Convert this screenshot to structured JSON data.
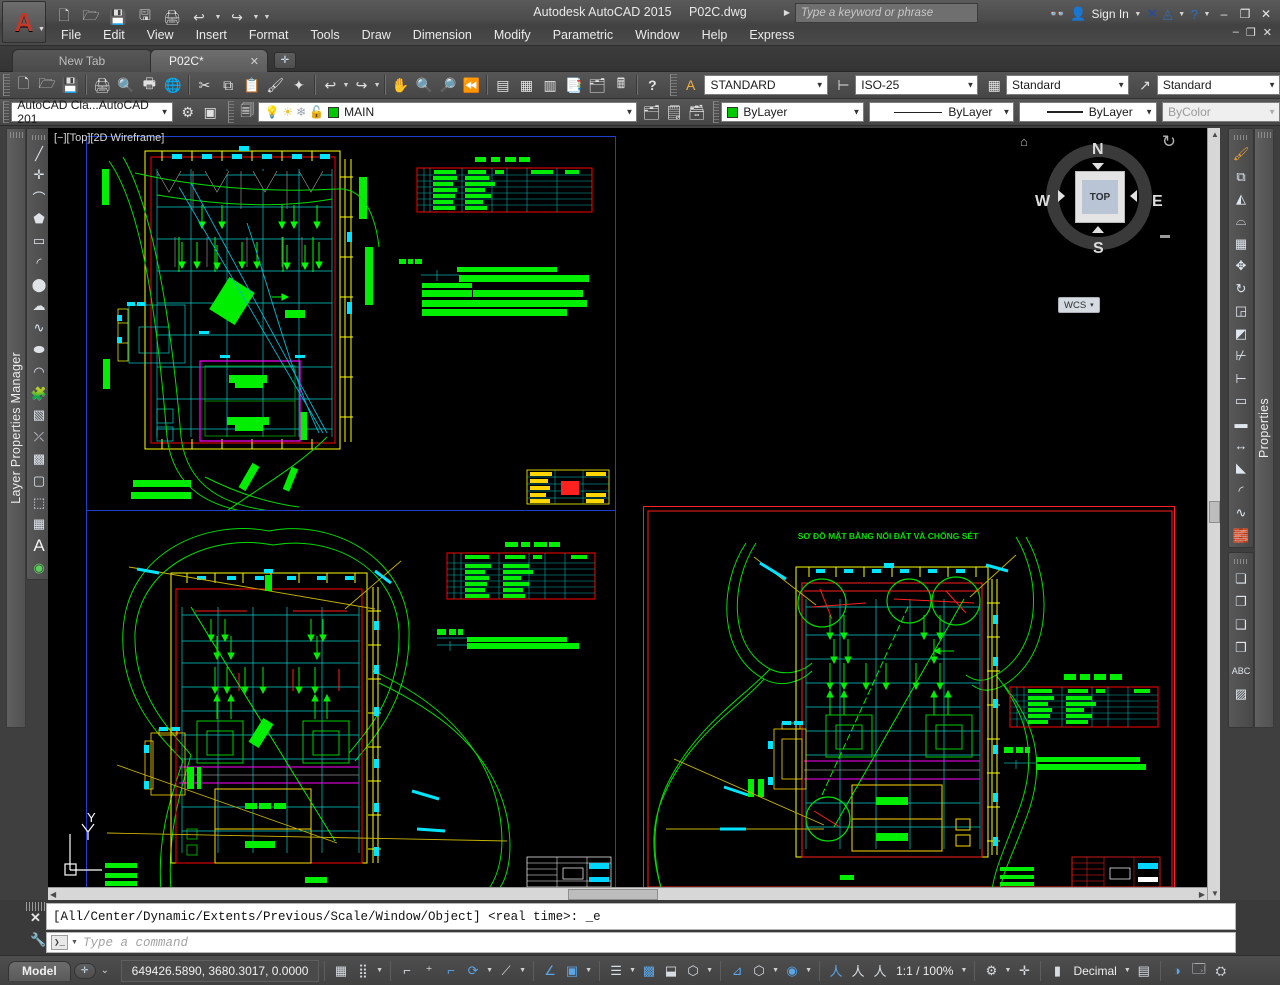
{
  "titlebar": {
    "app_logo": "autocad-a-logo",
    "product": "Autodesk AutoCAD 2015",
    "filename": "P02C.dwg",
    "search_placeholder": "Type a keyword or phrase",
    "signin_label": "Sign In",
    "quick_access": [
      {
        "name": "new-file-icon",
        "glyph": "🗋"
      },
      {
        "name": "open-file-icon",
        "glyph": "🗁"
      },
      {
        "name": "save-icon",
        "glyph": "💾"
      },
      {
        "name": "save-as-icon",
        "glyph": "🖫"
      },
      {
        "name": "plot-icon",
        "glyph": "🖨"
      },
      {
        "name": "undo-icon",
        "glyph": "↩"
      },
      {
        "name": "redo-icon",
        "glyph": "↪"
      },
      {
        "name": "customize-qat-icon",
        "glyph": "▼"
      }
    ],
    "right_icons": [
      {
        "name": "search-binoculars-icon",
        "glyph": "👓"
      },
      {
        "name": "user-account-icon",
        "glyph": "👤"
      },
      {
        "name": "exchange-app-icon",
        "glyph": "✕"
      },
      {
        "name": "autodesk-360-icon",
        "glyph": "◬"
      },
      {
        "name": "help-icon",
        "glyph": "?"
      }
    ],
    "window_buttons": [
      {
        "name": "minimize-button",
        "glyph": "–"
      },
      {
        "name": "restore-button",
        "glyph": "❐"
      },
      {
        "name": "close-button",
        "glyph": "✕"
      }
    ],
    "inner_window_buttons": [
      {
        "name": "doc-minimize-button",
        "glyph": "–"
      },
      {
        "name": "doc-restore-button",
        "glyph": "❐"
      },
      {
        "name": "doc-close-button",
        "glyph": "✕"
      }
    ]
  },
  "menubar": {
    "items": [
      {
        "label": "File"
      },
      {
        "label": "Edit"
      },
      {
        "label": "View"
      },
      {
        "label": "Insert"
      },
      {
        "label": "Format"
      },
      {
        "label": "Tools"
      },
      {
        "label": "Draw"
      },
      {
        "label": "Dimension"
      },
      {
        "label": "Modify"
      },
      {
        "label": "Parametric"
      },
      {
        "label": "Window"
      },
      {
        "label": "Help"
      },
      {
        "label": "Express"
      }
    ]
  },
  "file_tabs": {
    "new_tab_label": "New Tab",
    "active_tab_label": "P02C*",
    "close_glyph": "✕",
    "add_tab_glyph": "✛"
  },
  "standard_toolbar": {
    "icons": [
      {
        "name": "qnew-icon",
        "glyph": "🗋"
      },
      {
        "name": "open-icon",
        "glyph": "🗁"
      },
      {
        "name": "save-icon",
        "glyph": "💾"
      },
      {
        "name": "plot-icon",
        "glyph": "🖨"
      },
      {
        "name": "plot-preview-icon",
        "glyph": "🔍"
      },
      {
        "name": "publish-icon",
        "glyph": "🖶"
      },
      {
        "name": "3dprint-icon",
        "glyph": "🌐"
      },
      {
        "name": "cut-icon",
        "glyph": "✂"
      },
      {
        "name": "copy-icon",
        "glyph": "⧉"
      },
      {
        "name": "paste-icon",
        "glyph": "📋"
      },
      {
        "name": "match-properties-icon",
        "glyph": "🖌"
      },
      {
        "name": "block-editor-icon",
        "glyph": "✦"
      },
      {
        "name": "undo-icon",
        "glyph": "↩"
      },
      {
        "name": "redo-icon",
        "glyph": "↪"
      },
      {
        "name": "pan-icon",
        "glyph": "✋"
      },
      {
        "name": "zoom-realtime-icon",
        "glyph": "🔍"
      },
      {
        "name": "zoom-window-icon",
        "glyph": "🔎"
      },
      {
        "name": "zoom-previous-icon",
        "glyph": "⏪"
      },
      {
        "name": "properties-palette-icon",
        "glyph": "▤"
      },
      {
        "name": "designcenter-icon",
        "glyph": "▦"
      },
      {
        "name": "tool-palettes-icon",
        "glyph": "▥"
      },
      {
        "name": "sheet-set-manager-icon",
        "glyph": "📑"
      },
      {
        "name": "markup-set-manager-icon",
        "glyph": "🗂"
      },
      {
        "name": "quick-calc-icon",
        "glyph": "🖩"
      },
      {
        "name": "help-icon",
        "glyph": "?"
      }
    ]
  },
  "styles_toolbar": {
    "text_style": {
      "label": "STANDARD",
      "icon": "text-style-icon"
    },
    "dimension_style": {
      "label": "ISO-25",
      "icon": "dimension-style-icon"
    },
    "table_style": {
      "label": "Standard",
      "icon": "table-style-icon"
    },
    "multileader_style": {
      "label": "Standard",
      "icon": "multileader-style-icon"
    }
  },
  "workspace_toolbar": {
    "workspace": "AutoCAD Cla...AutoCAD 201",
    "icons": [
      {
        "name": "workspace-settings-icon",
        "glyph": "⚙"
      },
      {
        "name": "toolbar-lock-icon",
        "glyph": "▣"
      }
    ]
  },
  "layer_toolbar": {
    "layer_properties_icon": "layer-properties-manager-icon",
    "current_layer": "MAIN",
    "layer_color_hex": "#00c800",
    "state_icons": [
      {
        "name": "layer-on-bulb-icon",
        "glyph": "💡"
      },
      {
        "name": "layer-freeze-sun-icon",
        "glyph": "☀"
      },
      {
        "name": "layer-freeze-vp-icon",
        "glyph": "❄"
      },
      {
        "name": "layer-unlock-icon",
        "glyph": "🔓"
      }
    ],
    "trailing_icons": [
      {
        "name": "layer-previous-icon",
        "glyph": "🗂"
      },
      {
        "name": "make-object-layer-current-icon",
        "glyph": "🗒"
      },
      {
        "name": "layer-states-icon",
        "glyph": "🗃"
      }
    ]
  },
  "properties_toolbar": {
    "color": {
      "label": "ByLayer",
      "swatch_hex": "#00c800"
    },
    "linetype": {
      "label": "ByLayer"
    },
    "lineweight": {
      "label": "ByLayer"
    },
    "plotstyle": {
      "label": "ByColor",
      "disabled": true
    }
  },
  "left_dock": {
    "panel_title": "Layer Properties Manager",
    "draw_toolbar": [
      {
        "name": "line-icon",
        "glyph": "╱"
      },
      {
        "name": "construction-line-icon",
        "glyph": "✛"
      },
      {
        "name": "polyline-icon",
        "glyph": "⌒"
      },
      {
        "name": "polygon-icon",
        "glyph": "⬟"
      },
      {
        "name": "rectangle-icon",
        "glyph": "▭"
      },
      {
        "name": "arc-icon",
        "glyph": "◜"
      },
      {
        "name": "circle-icon",
        "glyph": "◯"
      },
      {
        "name": "revision-cloud-icon",
        "glyph": "☁"
      },
      {
        "name": "spline-icon",
        "glyph": "∿"
      },
      {
        "name": "ellipse-icon",
        "glyph": "⬭"
      },
      {
        "name": "ellipse-arc-icon",
        "glyph": "◠"
      },
      {
        "name": "insert-block-icon",
        "glyph": "🧩"
      },
      {
        "name": "make-block-icon",
        "glyph": "▧"
      },
      {
        "name": "point-icon",
        "glyph": "⨯"
      },
      {
        "name": "hatch-icon",
        "glyph": "▩"
      },
      {
        "name": "gradient-icon",
        "glyph": "▢"
      },
      {
        "name": "region-icon",
        "glyph": "⬚"
      },
      {
        "name": "table-icon",
        "glyph": "▦"
      },
      {
        "name": "multiline-text-icon",
        "glyph": "A"
      },
      {
        "name": "add-selected-icon",
        "glyph": "◉"
      }
    ]
  },
  "right_dock": {
    "panel_title": "Properties",
    "modify_toolbar": [
      {
        "name": "erase-icon",
        "glyph": "🖌"
      },
      {
        "name": "copy-object-icon",
        "glyph": "⧉"
      },
      {
        "name": "mirror-icon",
        "glyph": "◭"
      },
      {
        "name": "offset-icon",
        "glyph": "⌓"
      },
      {
        "name": "array-icon",
        "glyph": "▦"
      },
      {
        "name": "move-icon",
        "glyph": "✥"
      },
      {
        "name": "rotate-icon",
        "glyph": "↻"
      },
      {
        "name": "scale-icon",
        "glyph": "◲"
      },
      {
        "name": "stretch-icon",
        "glyph": "◩"
      },
      {
        "name": "trim-icon",
        "glyph": "✂"
      },
      {
        "name": "extend-icon",
        "glyph": "⇥"
      },
      {
        "name": "break-at-point-icon",
        "glyph": "▭"
      },
      {
        "name": "break-icon",
        "glyph": "▬"
      },
      {
        "name": "join-icon",
        "glyph": "↔"
      },
      {
        "name": "chamfer-icon",
        "glyph": "◣"
      },
      {
        "name": "fillet-icon",
        "glyph": "◜"
      },
      {
        "name": "blend-curves-icon",
        "glyph": "∿"
      },
      {
        "name": "explode-icon",
        "glyph": "💥"
      }
    ],
    "draworder_toolbar": [
      {
        "name": "bring-to-front-icon",
        "glyph": "❏"
      },
      {
        "name": "send-to-back-icon",
        "glyph": "❐"
      },
      {
        "name": "bring-above-object-icon",
        "glyph": "❑"
      },
      {
        "name": "send-under-object-icon",
        "glyph": "❒"
      },
      {
        "name": "bring-text-to-front-icon",
        "glyph": "🔤"
      },
      {
        "name": "send-hatches-to-back-icon",
        "glyph": "▨"
      }
    ]
  },
  "canvas": {
    "viewport_label": "[−][Top][2D Wireframe]",
    "ucs_axis_label": "Y",
    "viewcube": {
      "face_label": "TOP",
      "north": "N",
      "south": "S",
      "east": "E",
      "west": "W",
      "home_icon": "home-icon",
      "rotate_icon": "rotate-arrow-icon",
      "coordinate_system": "WCS",
      "wcs_caret": "▾"
    },
    "drawings": [
      {
        "name": "top-left-drawing",
        "title": "",
        "frame_color": "#1f3fd0"
      },
      {
        "name": "bottom-left-drawing",
        "title": "",
        "frame_color": "#1f3fd0"
      },
      {
        "name": "right-drawing",
        "title": "SƠ ĐỒ MẶT BẰNG NỐI ĐẤT VÀ CHỐNG SÉT",
        "title_color": "#00e000",
        "frame_color": "#ff2020"
      }
    ],
    "entity_colors": {
      "green": "#00ff00",
      "cyan": "#00ffff",
      "yellow": "#ffff00",
      "red": "#ff0000",
      "magenta": "#ff00ff",
      "white": "#ffffff",
      "gray": "#909090",
      "dark_yellow": "#b0a000"
    }
  },
  "command_line": {
    "history": "[All/Center/Dynamic/Extents/Previous/Scale/Window/Object] <real time>: _e",
    "prompt_glyph": "❯_",
    "placeholder": "Type a command",
    "close_glyph": "✕",
    "customize_icon": "wrench-icon"
  },
  "statusbar": {
    "model_tab": "Model",
    "add_layout_glyph": "✛",
    "layout_overflow_glyph": "⌄",
    "coordinates": "649426.5890, 3680.3017, 0.0000",
    "annotation_scale": "1:1 / 100%",
    "units": "Decimal",
    "toggles": [
      {
        "name": "grid-display-toggle",
        "glyph": "▦",
        "active": false
      },
      {
        "name": "snap-mode-toggle",
        "glyph": "⣿",
        "active": false
      },
      {
        "name": "infer-constraints-toggle",
        "glyph": "⌐",
        "active": false
      },
      {
        "name": "dynamic-input-toggle",
        "glyph": "⁺",
        "active": false
      },
      {
        "name": "ortho-mode-toggle",
        "glyph": "⌐",
        "active": true
      },
      {
        "name": "polar-tracking-toggle",
        "glyph": "⟳",
        "active": true
      },
      {
        "name": "object-snap-toggle",
        "glyph": "⟋",
        "active": false
      },
      {
        "name": "3d-object-snap-toggle",
        "glyph": "∠",
        "active": true
      },
      {
        "name": "object-snap-tracking-toggle",
        "glyph": "▣",
        "active": true
      },
      {
        "name": "lineweight-toggle",
        "glyph": "▤",
        "active": false
      },
      {
        "name": "transparency-toggle",
        "glyph": "▩",
        "active": true
      },
      {
        "name": "selection-cycling-toggle",
        "glyph": "⬓",
        "active": false
      },
      {
        "name": "annotation-monitor-toggle",
        "glyph": "◈",
        "active": false
      },
      {
        "name": "ucs-icon-toggle",
        "glyph": "⊿",
        "active": true
      },
      {
        "name": "isometric-drafting-toggle",
        "glyph": "⬡",
        "active": false
      },
      {
        "name": "workspace-switching-icon",
        "glyph": "⚙",
        "active": false
      },
      {
        "name": "annotation-visibility-icon",
        "glyph": "人",
        "active": true
      },
      {
        "name": "autoscale-icon",
        "glyph": "人",
        "active": false
      },
      {
        "name": "annotation-scale-icon",
        "glyph": "人",
        "active": false
      },
      {
        "name": "customization-icon",
        "glyph": "☰",
        "active": false
      },
      {
        "name": "hardware-acceleration-icon",
        "glyph": "◑",
        "active": true
      },
      {
        "name": "clean-screen-icon",
        "glyph": "⛶",
        "active": false
      }
    ]
  }
}
